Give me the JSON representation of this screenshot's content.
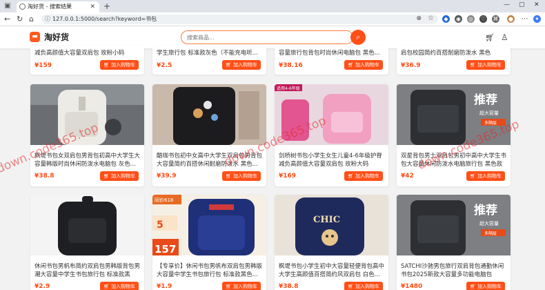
{
  "browser": {
    "tab_title": "淘好货 - 搜索结果",
    "url": "127.0.0.1:5000/search?keyword=书包",
    "new_tab_label": "+"
  },
  "site": {
    "logo_text": "淘好货",
    "search_placeholder": "搜索商品..."
  },
  "watermark": "down.code365.top",
  "products": [
    {
      "title": "减负高颜值大容量双肩包 玫粉小码",
      "price": "¥159",
      "button": "加入购物车"
    },
    {
      "title": "学生旅行包 标准款灰色（不能充电听...",
      "price": "¥2.5",
      "button": "加入购物车"
    },
    {
      "title": "容量旅行包背包时尚休闲电脑包 黑色...",
      "price": "¥38.16",
      "button": "加入购物车"
    },
    {
      "title": "肩包校园简约百搭耐磨防泼水 黑色（带...",
      "price": "¥36.9",
      "button": "加入购物车"
    },
    {
      "title": "枫堤书包女双肩包男背包初高中大学生大容量韩版时尚休闲防泼水电脑包 灰色...",
      "price": "¥38.8",
      "button": "加入购物车"
    },
    {
      "title": "酷咖书包初中女高中大学生双肩包男背包大容量简约百搭休闲耐磨防泼水 黑色...",
      "price": "¥39.9",
      "button": "加入购物车"
    },
    {
      "title": "剑桥树书包小学生女生儿童4-6年级护脊减负高颜值大容量双肩包 玫粉大码",
      "price": "¥169",
      "button": "加入购物车"
    },
    {
      "title": "双星背包男士双肩包男初中高中大学生书包大容量休闲防泼水电脑旅行包 黑色款",
      "price": "¥42",
      "button": "加入购物车"
    },
    {
      "title": "休闲书包男帆布简约双肩包男韩版背包男潮大容量中学生书包旅行包 标准款黑色...",
      "price": "¥2.9",
      "button": "加入购物车"
    },
    {
      "title": "【专享价】休闲书包男帆布双肩包男韩版大容量中学生书包旅行包 标准款黑色...",
      "price": "¥1.9",
      "button": "加入购物车"
    },
    {
      "title": "枫堤书包小学生初中大容量轻便背包高中大学生高颜值百搭简约风双肩包 白色...",
      "price": "¥38.8",
      "button": "加入购物车"
    },
    {
      "title": "SATCHI沙驰男包旅行双肩背包通勤休闲书包2025新款大容量多功能电脑包",
      "price": "¥1480",
      "button": "加入购物车"
    }
  ],
  "image_text": {
    "p7_banner": "适用4-6年级",
    "p8_big": "推荐",
    "p8_sub": "超大容量",
    "p8_tag": "多隔层",
    "p10_badge": "同价618",
    "p10_num": "5",
    "p10_num2": "157",
    "p11_logo": "CHIC",
    "p12_big": "推荐",
    "p12_sub": "超大容量",
    "p12_tag": "多隔层"
  },
  "colors": {
    "accent": "#ff4f17",
    "price": "#ff4a12"
  },
  "icons": [
    "cart-icon",
    "user-icon",
    "search-icon",
    "back-icon",
    "forward-icon",
    "reload-icon",
    "home-icon"
  ]
}
